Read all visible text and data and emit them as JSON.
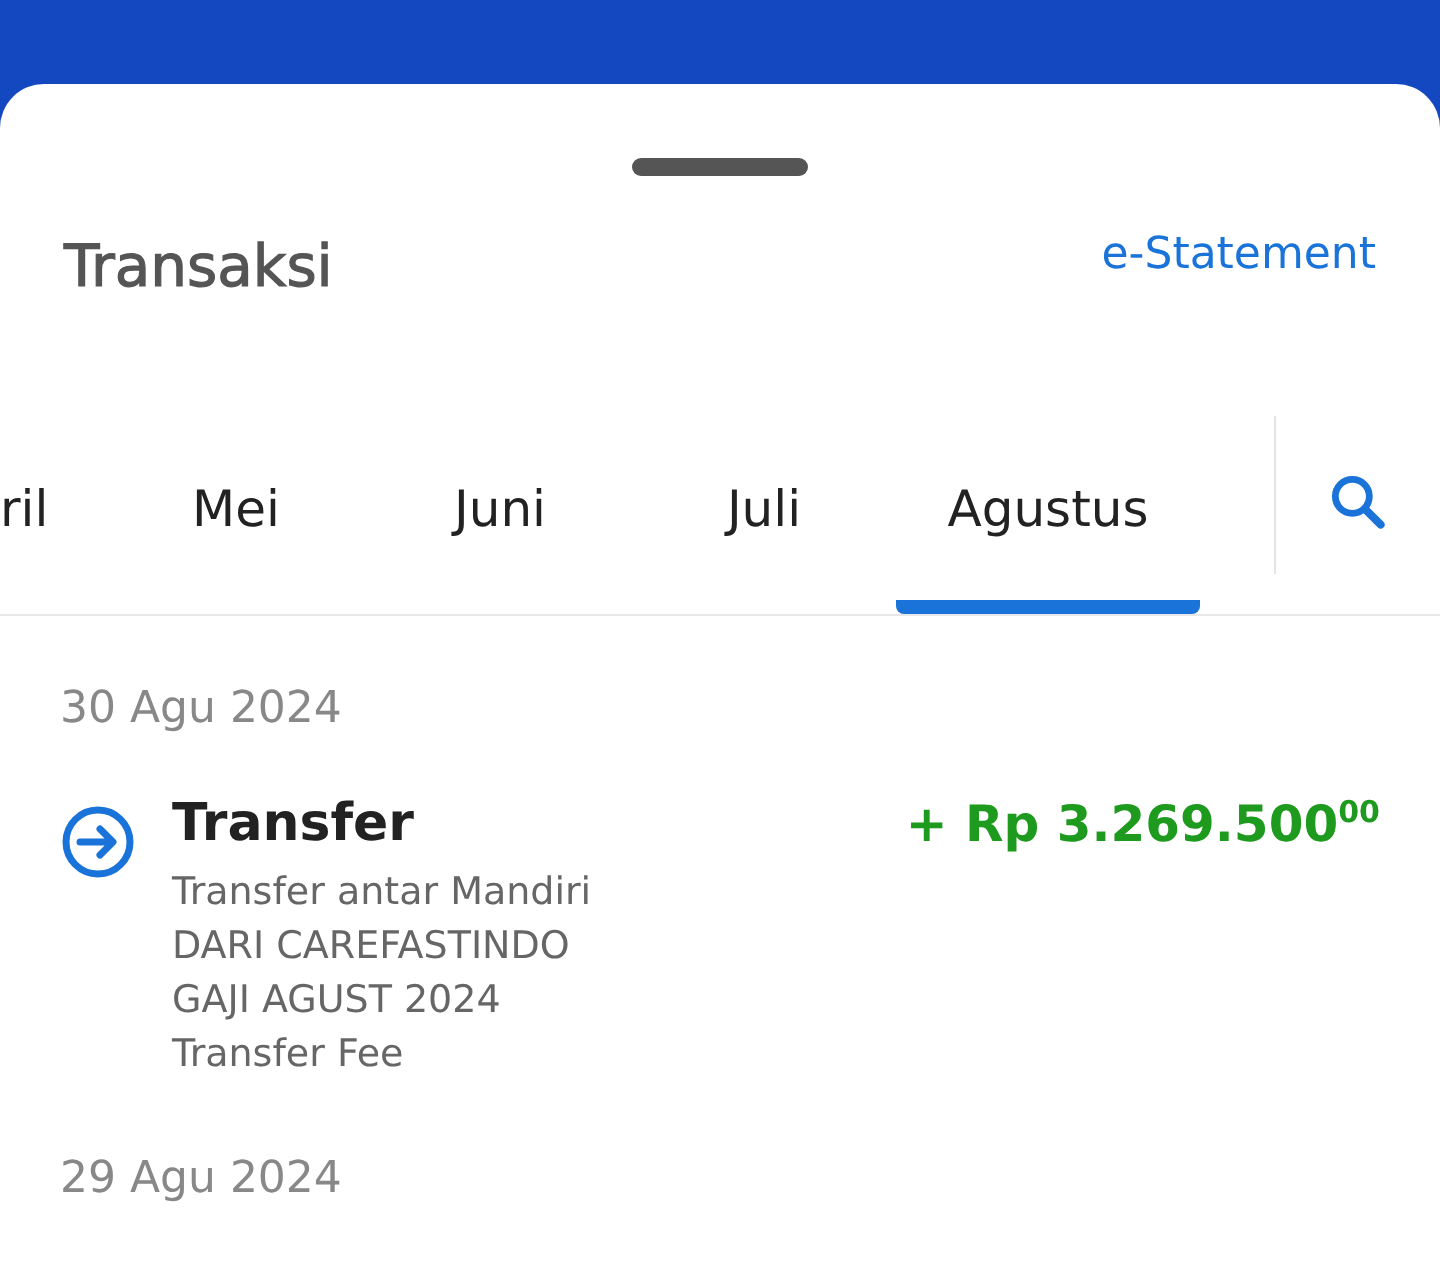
{
  "header": {
    "title": "Transaksi",
    "statement_link": "e-Statement"
  },
  "tabs": [
    {
      "label": "ril",
      "selected": false
    },
    {
      "label": "Mei",
      "selected": false
    },
    {
      "label": "Juni",
      "selected": false
    },
    {
      "label": "Juli",
      "selected": false
    },
    {
      "label": "Agustus",
      "selected": true
    }
  ],
  "groups": [
    {
      "date": "30 Agu 2024",
      "transactions": [
        {
          "title": "Transfer",
          "amount": "+ Rp 3.269.500$^{00}$",
          "kind": "incoming",
          "details": [
            "Transfer antar Mandiri",
            "DARI CAREFASTINDO",
            "GAJI AGUST 2024",
            "Transfer Fee"
          ]
        }
      ]
    },
    {
      "date": "29 Agu 2024"
    }
  ]
}
